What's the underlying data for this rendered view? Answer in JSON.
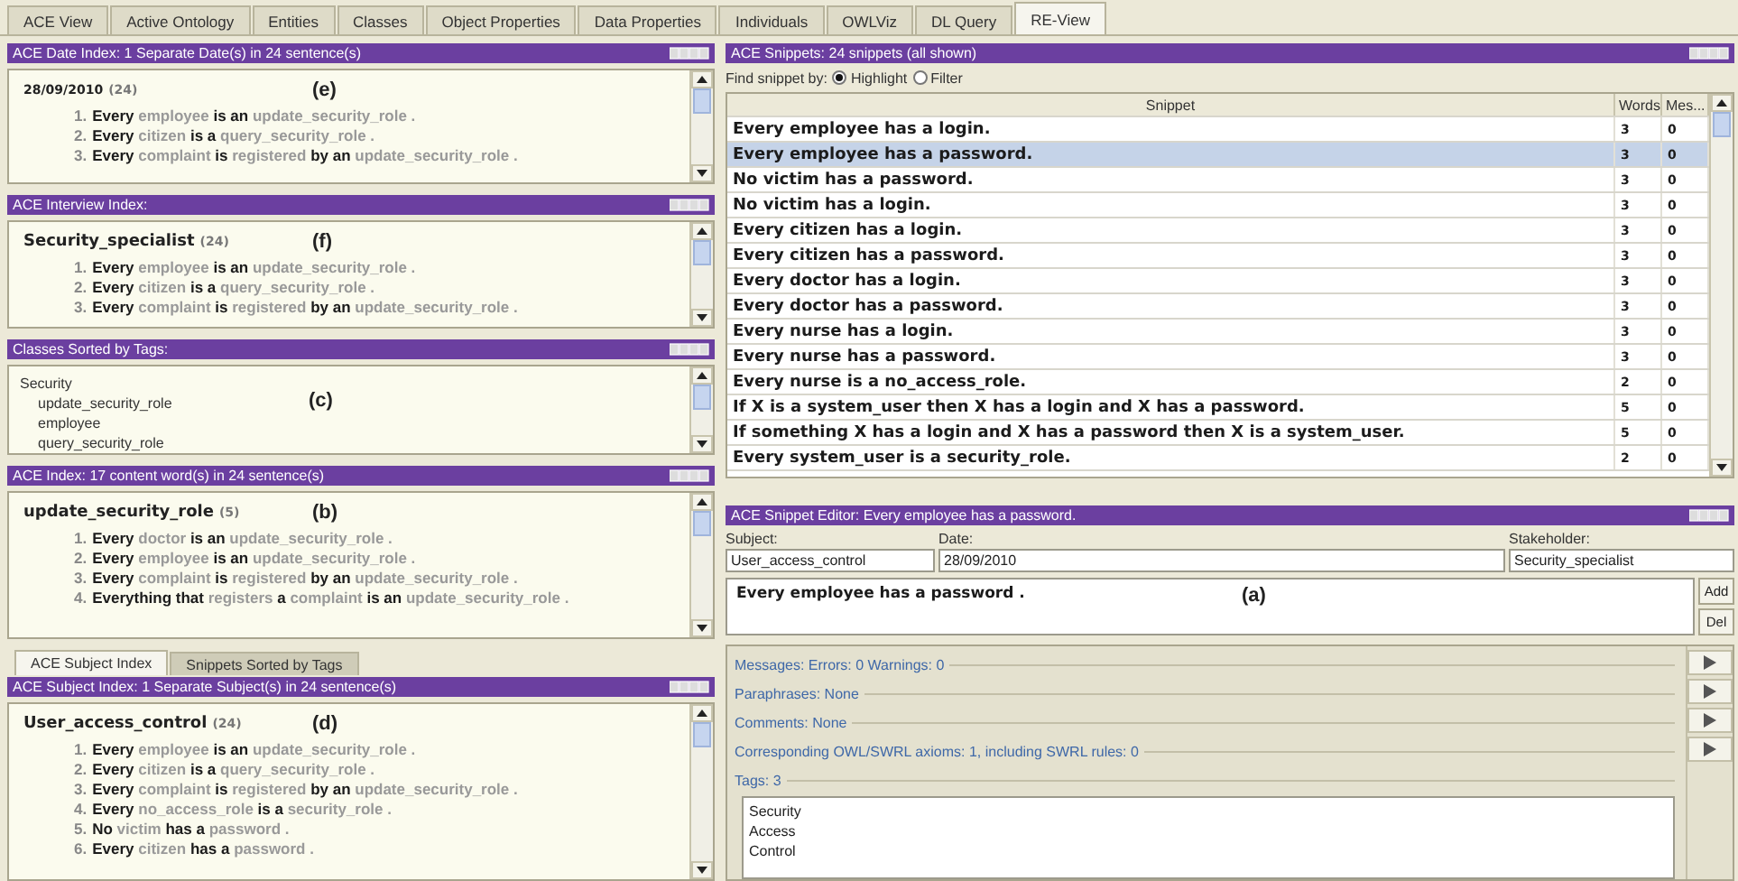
{
  "tabs": [
    {
      "label": "ACE View",
      "selected": false
    },
    {
      "label": "Active Ontology",
      "selected": false
    },
    {
      "label": "Entities",
      "selected": false
    },
    {
      "label": "Classes",
      "selected": false
    },
    {
      "label": "Object Properties",
      "selected": false
    },
    {
      "label": "Data Properties",
      "selected": false
    },
    {
      "label": "Individuals",
      "selected": false
    },
    {
      "label": "OWLViz",
      "selected": false
    },
    {
      "label": "DL Query",
      "selected": false
    },
    {
      "label": "RE-View",
      "selected": true
    }
  ],
  "left_panels": [
    {
      "kind": "sentences",
      "title": "ACE Date Index: 1 Separate Date(s) in 24 sentence(s)",
      "heading": "28/09/2010",
      "small_heading": true,
      "count": "(24)",
      "annotation": "(e)",
      "sentences": [
        {
          "number": "1.",
          "text": "**Every** employee **is an** update_security_role ."
        },
        {
          "number": "2.",
          "text": "**Every** citizen **is a** query_security_role ."
        },
        {
          "number": "3.",
          "text": "**Every** complaint **is** registered **by an** update_security_role ."
        }
      ]
    },
    {
      "kind": "sentences",
      "title": "ACE Interview Index:",
      "heading": "Security_specialist",
      "count": "(24)",
      "annotation": "(f)",
      "sentences": [
        {
          "number": "1.",
          "text": "**Every** employee **is an** update_security_role ."
        },
        {
          "number": "2.",
          "text": "**Every** citizen **is a** query_security_role ."
        },
        {
          "number": "3.",
          "text": "**Every** complaint **is** registered **by an** update_security_role ."
        }
      ]
    },
    {
      "kind": "tree",
      "title": "Classes Sorted by Tags:",
      "annotation": "(c)",
      "tree": [
        {
          "label": "Security",
          "children": [
            {
              "label": "update_security_role"
            },
            {
              "label": "employee"
            },
            {
              "label": "query_security_role"
            }
          ]
        }
      ]
    },
    {
      "kind": "sentences",
      "title": "ACE Index: 17 content word(s) in 24 sentence(s)",
      "heading": "update_security_role",
      "count": "(5)",
      "annotation": "(b)",
      "sentences": [
        {
          "number": "1.",
          "text": "**Every** doctor **is an** update_security_role ."
        },
        {
          "number": "2.",
          "text": "**Every** employee **is an** update_security_role ."
        },
        {
          "number": "3.",
          "text": "**Every** complaint **is** registered **by an** update_security_role ."
        },
        {
          "number": "4.",
          "text": "**Everything that** registers **a** complaint **is an** update_security_role ."
        }
      ]
    }
  ],
  "subtabs": [
    {
      "label": "ACE Subject Index",
      "selected": true
    },
    {
      "label": "Snippets Sorted by Tags",
      "selected": false
    }
  ],
  "subject_panel": {
    "kind": "sentences",
    "title": "ACE Subject Index: 1 Separate Subject(s) in 24 sentence(s)",
    "heading": "User_access_control",
    "count": "(24)",
    "annotation": "(d)",
    "sentences": [
      {
        "number": "1.",
        "text": "**Every** employee **is an** update_security_role ."
      },
      {
        "number": "2.",
        "text": "**Every** citizen **is a** query_security_role ."
      },
      {
        "number": "3.",
        "text": "**Every** complaint **is** registered **by an** update_security_role ."
      },
      {
        "number": "4.",
        "text": "**Every** no_access_role **is a** security_role ."
      },
      {
        "number": "5.",
        "text": "**No** victim **has a** password ."
      },
      {
        "number": "6.",
        "text": "**Every** citizen **has a** password ."
      }
    ]
  },
  "snippets": {
    "title": "ACE Snippets: 24 snippets (all shown)",
    "find_label": "Find snippet by:",
    "options": [
      {
        "label": "Highlight",
        "selected": true
      },
      {
        "label": "Filter",
        "selected": false
      }
    ],
    "columns": [
      "Snippet",
      "Words",
      "Mes..."
    ],
    "rows": [
      {
        "snippet": "Every employee has a login.",
        "words": "3",
        "messages": "0",
        "selected": false
      },
      {
        "snippet": "Every employee has a password.",
        "words": "3",
        "messages": "0",
        "selected": true
      },
      {
        "snippet": "No victim has a password.",
        "words": "3",
        "messages": "0",
        "selected": false
      },
      {
        "snippet": "No victim has a login.",
        "words": "3",
        "messages": "0",
        "selected": false
      },
      {
        "snippet": "Every citizen has a login.",
        "words": "3",
        "messages": "0",
        "selected": false
      },
      {
        "snippet": "Every citizen has a password.",
        "words": "3",
        "messages": "0",
        "selected": false
      },
      {
        "snippet": "Every doctor has a login.",
        "words": "3",
        "messages": "0",
        "selected": false
      },
      {
        "snippet": "Every doctor has a password.",
        "words": "3",
        "messages": "0",
        "selected": false
      },
      {
        "snippet": "Every nurse has a login.",
        "words": "3",
        "messages": "0",
        "selected": false
      },
      {
        "snippet": "Every nurse has a password.",
        "words": "3",
        "messages": "0",
        "selected": false
      },
      {
        "snippet": "Every nurse is a no_access_role.",
        "words": "2",
        "messages": "0",
        "selected": false
      },
      {
        "snippet": "If X is a system_user then X has a login and X has a password.",
        "words": "5",
        "messages": "0",
        "selected": false
      },
      {
        "snippet": "If something X has a login and X has a password then X is a system_user.",
        "words": "5",
        "messages": "0",
        "selected": false
      },
      {
        "snippet": "Every system_user is a security_role.",
        "words": "2",
        "messages": "0",
        "selected": false
      }
    ]
  },
  "editor": {
    "title": "ACE Snippet Editor: Every employee has a password.",
    "fields": [
      {
        "label": "Subject:",
        "value": "User_access_control"
      },
      {
        "label": "Date:",
        "value": "28/09/2010"
      },
      {
        "label": "Stakeholder:",
        "value": "Security_specialist"
      }
    ],
    "text": "Every employee has a password .",
    "annotation": "(a)",
    "buttons": [
      "Add",
      "Del"
    ],
    "sections": [
      {
        "kind": "collapsed",
        "label": "Messages: Errors: 0  Warnings: 0"
      },
      {
        "kind": "collapsed",
        "label": "Paraphrases: None"
      },
      {
        "kind": "collapsed",
        "label": "Comments: None"
      },
      {
        "kind": "collapsed",
        "label": "Corresponding OWL/SWRL axioms: 1, including SWRL rules: 0"
      },
      {
        "kind": "list",
        "label": "Tags: 3",
        "items": [
          "Security",
          "Access",
          "Control"
        ]
      }
    ]
  }
}
